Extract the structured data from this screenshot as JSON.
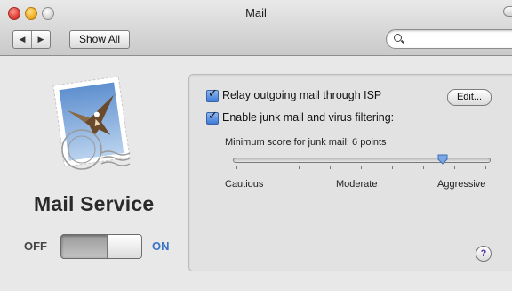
{
  "window": {
    "title": "Mail"
  },
  "toolbar": {
    "back_glyph": "◀",
    "forward_glyph": "▶",
    "show_all_label": "Show All",
    "search": {
      "value": "",
      "placeholder": ""
    }
  },
  "service": {
    "name": "Mail Service",
    "off_label": "OFF",
    "on_label": "ON",
    "state": "on"
  },
  "settings": {
    "relay": {
      "label": "Relay outgoing mail through ISP",
      "checked": true
    },
    "edit_label": "Edit...",
    "junk": {
      "label": "Enable junk mail and virus filtering:",
      "checked": true
    },
    "min_score_label": "Minimum score for junk mail:  6 points",
    "slider": {
      "value_fraction": 0.83,
      "tick_count": 9
    },
    "scale_labels": {
      "left": "Cautious",
      "middle": "Moderate",
      "right": "Aggressive"
    }
  },
  "help_label": "?",
  "colors": {
    "on_accent": "#3a72c4",
    "checkbox": "#3d7bd6"
  }
}
